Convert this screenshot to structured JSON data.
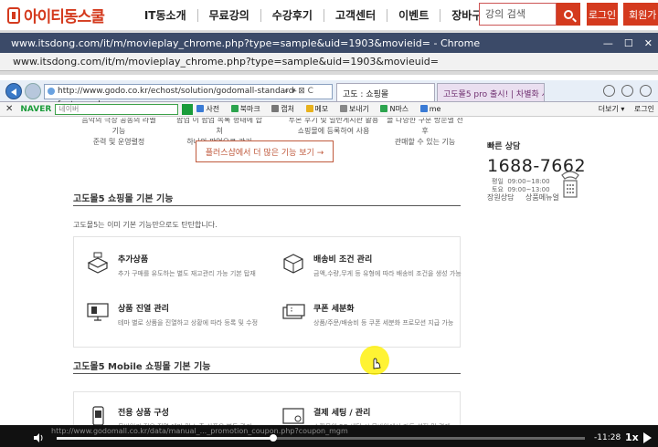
{
  "site": {
    "logo": "아이티동스쿨",
    "nav": [
      "IT동소개",
      "무료강의",
      "수강후기",
      "고객센터",
      "이벤트",
      "장바구니"
    ],
    "search_placeholder": "강의 검색",
    "login": "로그인",
    "join": "회원가"
  },
  "chrome": {
    "title": "www.itsdong.com/it/m/movieplay_chrome.php?type=sample&uid=1903&movieid= - Chrome",
    "url": "www.itsdong.com/it/m/movieplay_chrome.php?type=sample&uid=1903&movieuid="
  },
  "ie": {
    "url": "http://www.godo.co.kr/echost/solution/godomall-standard-feature.gd",
    "url_icons": "⌕ ▾ ⊠ C",
    "tab_active": "고도 : 쇼핑몰",
    "tab_second": "고도몰5 pro 출시! | 차별화 시...",
    "toolbar": {
      "search_placeholder": "네이버",
      "items": [
        "사전",
        "북마크",
        "캡처",
        "메모",
        "보내기",
        "N마스",
        "me"
      ],
      "right": [
        "더보기 ▾",
        "로그인"
      ]
    }
  },
  "page": {
    "cut_left_1": "음악의 극장 공동의 라벨기능",
    "cut_left_2": "준력 및 운영렬정",
    "cut_mid_1": "팝업 이 팝업 목록 형태에 합쳐",
    "cut_mid_2": "하나의 팝업으로 관리",
    "cut_right_1": "투본 후기 및 일반게시판 활용",
    "cut_right_2": "쇼핑몰에 등록하여 사용",
    "cut_far_1": "몰 다양한 구분 방문별 전후",
    "cut_far_2": "관매할 수 있는 기능",
    "more_button": "플러스샵에서 더 많은 기능 보기 →",
    "section1_title": "고도몰5 쇼핑몰 기본 기능",
    "section1_desc": "고도몰5는 이미 기본 기능만으로도 탄탄합니다.",
    "features": [
      {
        "title": "추가상품",
        "desc": "추가 구매를 유도하는 별도 재고관리 가능 기본 탑재"
      },
      {
        "title": "배송비 조건 관리",
        "desc": "금액,수량,무게 등 유형에 따라 배송비 조건을 생성 가능"
      },
      {
        "title": "상품 진열 관리",
        "desc": "테마 별로 상품을 진열하고 상황에 따라 등록 및 수정"
      },
      {
        "title": "쿠폰 세분화",
        "desc": "상품/주문/배송비 등 쿠폰 세분화 프로모션 지급 가능"
      }
    ],
    "section2_title": "고도몰5 Mobile 쇼핑몰 기본 기능",
    "mobile_features": [
      {
        "title": "전용 상품 구성",
        "desc": "모바일과 전용 진열 테마 및 노출 상품을 별도 관리"
      },
      {
        "title": "결제 세팅 / 관리",
        "desc": "쇼핑몰의 PG 세팅 시 모바일에서 자동 설정 및 결제"
      }
    ],
    "side": {
      "label": "빠른 상담",
      "phone": "1688-7662",
      "hours_1_label": "평일",
      "hours_1": "09:00~18:00",
      "hours_2_label": "토요",
      "hours_2": "09:00~13:00",
      "link_1": "장원상담",
      "link_2": "상품메뉴얼"
    }
  },
  "player": {
    "status_url": "http://www.godomall.co.kr/data/manual_..._promotion_coupon.php?coupon_mgm",
    "time": "-11:28",
    "speed": "1x",
    "progress": 0.41
  },
  "colors": {
    "brand": "#d43a1e",
    "chrome_title": "#3b4a68",
    "naver": "#1a9c3a"
  }
}
